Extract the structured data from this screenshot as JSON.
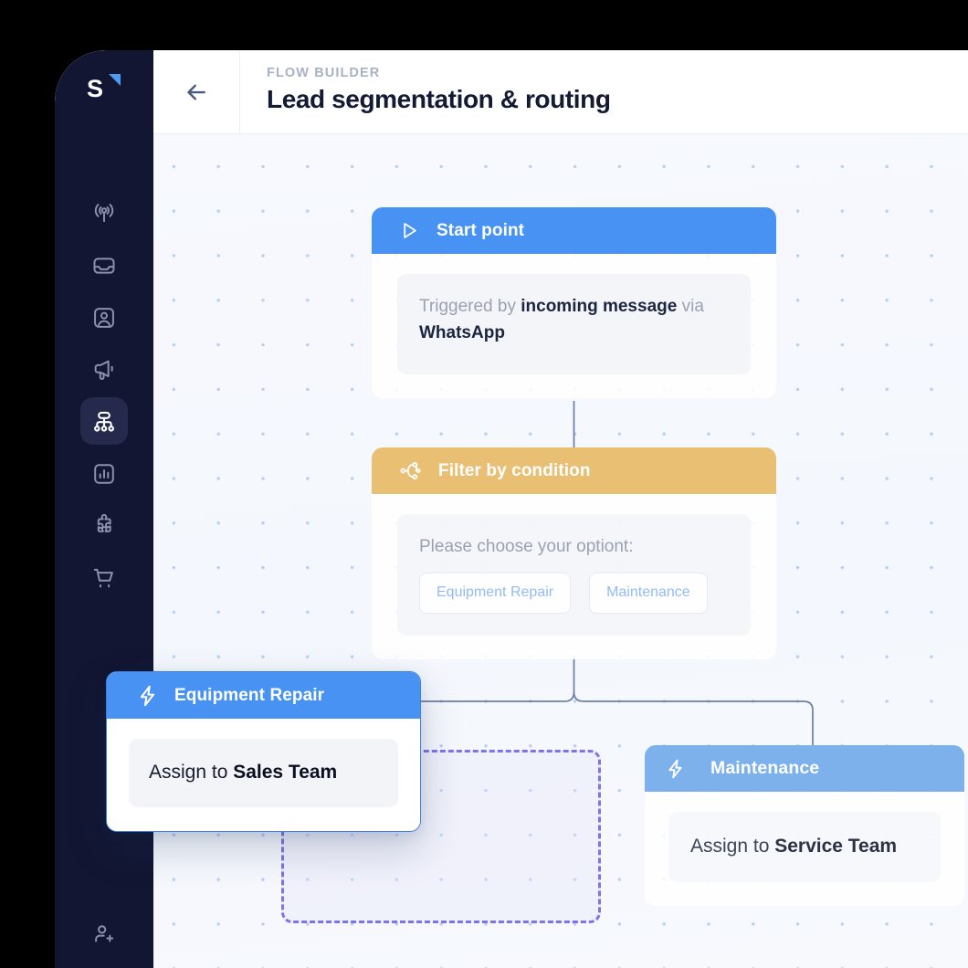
{
  "app": {
    "logo_letter": "S",
    "logo_icon": "triangle-accent"
  },
  "sidebar": {
    "items": [
      {
        "icon": "broadcast-icon",
        "name": "broadcast",
        "active": false
      },
      {
        "icon": "inbox-icon",
        "name": "inbox",
        "active": false
      },
      {
        "icon": "contact-card-icon",
        "name": "contacts",
        "active": false
      },
      {
        "icon": "megaphone-icon",
        "name": "campaigns",
        "active": false
      },
      {
        "icon": "flow-builder-icon",
        "name": "flow-builder",
        "active": true
      },
      {
        "icon": "analytics-icon",
        "name": "analytics",
        "active": false
      },
      {
        "icon": "integrations-icon",
        "name": "integrations",
        "active": false
      },
      {
        "icon": "shopping-cart-icon",
        "name": "commerce",
        "active": false
      }
    ],
    "bottom_item": {
      "icon": "add-user-icon",
      "name": "add-user"
    }
  },
  "header": {
    "back_icon": "arrow-left-icon",
    "eyebrow": "FLOW BUILDER",
    "title": "Lead segmentation & routing"
  },
  "canvas": {
    "nodes": {
      "start": {
        "icon": "play-icon",
        "title": "Start point",
        "body_prefix": "Triggered by ",
        "body_strong_1": "incoming message",
        "body_mid": " via ",
        "body_strong_2": "WhatsApp"
      },
      "filter": {
        "icon": "branch-icon",
        "title": "Filter by condition",
        "prompt": "Please choose your optiont:",
        "options": [
          "Equipment Repair",
          "Maintenance"
        ]
      },
      "equipment_repair": {
        "icon": "lightning-icon",
        "title": "Equipment Repair",
        "body_prefix": "Assign to ",
        "body_strong": "Sales Team",
        "state": "dragging"
      },
      "maintenance": {
        "icon": "lightning-icon",
        "title": "Maintenance",
        "body_prefix": "Assign to ",
        "body_strong": "Service Team"
      }
    },
    "dropzone": {
      "name": "drop-target-placeholder"
    }
  },
  "colors": {
    "sidebar_bg": "#121632",
    "accent_blue": "#4792f2",
    "node_blue_light": "#7cb1ec",
    "node_amber": "#e9bf73",
    "dropzone_purple": "#7d74e8",
    "title_dark": "#131a33",
    "grid_dot": "#b7cef4"
  }
}
